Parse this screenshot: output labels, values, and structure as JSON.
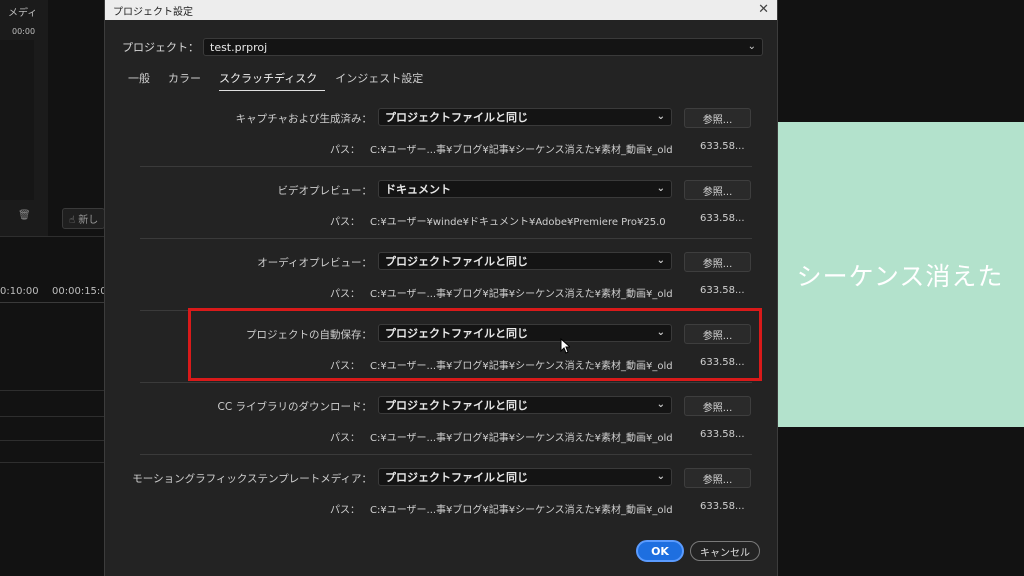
{
  "background": {
    "media_label": "メディ",
    "timecode_top": "00:00",
    "new_button": "新し",
    "timeline_ticks": [
      "0:10:00",
      "00:00:15:0"
    ],
    "preview_text": "シーケンス消えた",
    "preview_color": "#b3e2cc"
  },
  "dialog": {
    "title": "プロジェクト設定",
    "close_glyph": "✕",
    "project_label": "プロジェクト：",
    "project_value": "test.prproj",
    "tabs": [
      {
        "label": "一般",
        "active": false
      },
      {
        "label": "カラー",
        "active": false
      },
      {
        "label": "スクラッチディスク",
        "active": true
      },
      {
        "label": "インジェスト設定",
        "active": false
      }
    ],
    "path_label": "パス：",
    "browse_label": "参照...",
    "rows": [
      {
        "label": "キャプチャおよび生成済み：",
        "value": "プロジェクトファイルと同じ",
        "path": "C:¥ユーザー...事¥ブログ¥記事¥シーケンス消えた¥素材_動画¥_old",
        "size": "633.58..."
      },
      {
        "label": "ビデオプレビュー：",
        "value": "ドキュメント",
        "path": "C:¥ユーザー¥winde¥ドキュメント¥Adobe¥Premiere Pro¥25.0",
        "size": "633.58..."
      },
      {
        "label": "オーディオプレビュー：",
        "value": "プロジェクトファイルと同じ",
        "path": "C:¥ユーザー...事¥ブログ¥記事¥シーケンス消えた¥素材_動画¥_old",
        "size": "633.58..."
      },
      {
        "label": "プロジェクトの自動保存：",
        "value": "プロジェクトファイルと同じ",
        "path": "C:¥ユーザー...事¥ブログ¥記事¥シーケンス消えた¥素材_動画¥_old",
        "size": "633.58..."
      },
      {
        "label": "CC ライブラリのダウンロード：",
        "value": "プロジェクトファイルと同じ",
        "path": "C:¥ユーザー...事¥ブログ¥記事¥シーケンス消えた¥素材_動画¥_old",
        "size": "633.58..."
      },
      {
        "label": "モーショングラフィックステンプレートメディア：",
        "value": "プロジェクトファイルと同じ",
        "path": "C:¥ユーザー...事¥ブログ¥記事¥シーケンス消えた¥素材_動画¥_old",
        "size": "633.58..."
      }
    ],
    "ok_label": "OK",
    "cancel_label": "キャンセル",
    "highlight_color": "#d91a1a",
    "accent_color": "#1e6fe0"
  }
}
